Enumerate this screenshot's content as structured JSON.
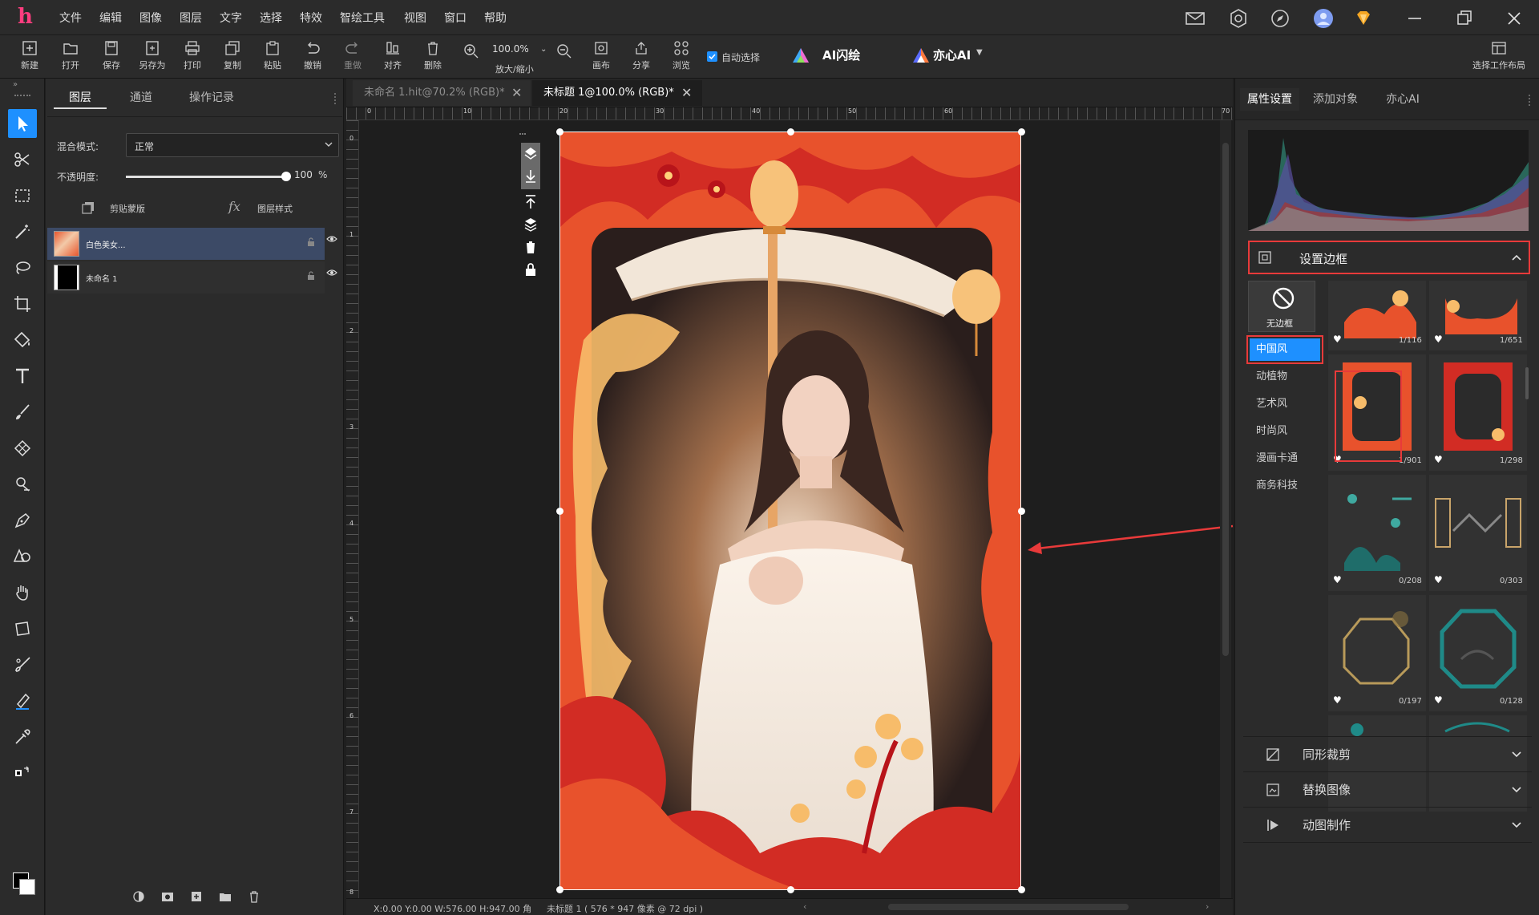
{
  "app": {
    "logo": "h",
    "colors": {
      "accent": "#1e90ff",
      "highlight": "#e83a3a",
      "bg": "#2b2b2b",
      "canvas": "#1e1e1e"
    }
  },
  "menu": [
    "文件",
    "编辑",
    "图像",
    "图层",
    "文字",
    "选择",
    "特效",
    "智绘工具",
    "视图",
    "窗口",
    "帮助"
  ],
  "toolbar": {
    "items": [
      "新建",
      "打开",
      "保存",
      "另存为",
      "打印",
      "复制",
      "粘贴",
      "撤销",
      "重做",
      "对齐",
      "删除"
    ],
    "zoom_value": "100.0%",
    "zoom_label": "放大/缩小",
    "right_items": [
      "画布",
      "分享",
      "浏览"
    ],
    "auto_select": "自动选择",
    "ai_flash": "AI闪绘",
    "yixin_ai": "亦心AI",
    "workspace": "选择工作布局"
  },
  "layers_panel": {
    "tabs": [
      "图层",
      "通道",
      "操作记录"
    ],
    "blend_label": "混合模式:",
    "blend_value": "正常",
    "opacity_label": "不透明度:",
    "opacity_value": "100",
    "opacity_unit": "%",
    "opacity_fraction": 1.0,
    "clip_mask": "剪贴蒙版",
    "layer_style": "图层样式",
    "layers": [
      {
        "name": "白色美女..."
      },
      {
        "name": "未命名 1"
      }
    ]
  },
  "doc_tabs": [
    {
      "title": "未命名 1.hit@70.2% (RGB)*"
    },
    {
      "title": "未标题 1@100.0% (RGB)*"
    }
  ],
  "ruler_marks": [
    "0",
    "10",
    "20",
    "30",
    "40",
    "50",
    "60",
    "70"
  ],
  "vruler_marks": [
    "0",
    "1",
    "2",
    "3",
    "4",
    "5",
    "6",
    "7",
    "8"
  ],
  "status": {
    "coords": "X:0.00 Y:0.00 W:576.00 H:947.00 角",
    "doc": "未标题 1 ( 576 * 947 像素 @ 72 dpi )"
  },
  "right_panel": {
    "tabs": [
      "属性设置",
      "添加对象",
      "亦心AI"
    ],
    "border_section": "设置边框",
    "no_border": "无边框",
    "categories": [
      "中国风",
      "动植物",
      "艺术风",
      "时尚风",
      "漫画卡通",
      "商务科技"
    ],
    "selected_category": "中国风",
    "thumbs": [
      {
        "count": "1/116"
      },
      {
        "count": "1/651"
      },
      {
        "count": "1/901"
      },
      {
        "count": "1/298"
      },
      {
        "count": "0/208"
      },
      {
        "count": "0/303"
      },
      {
        "count": "0/197"
      },
      {
        "count": "0/128"
      }
    ],
    "sections": [
      "同形裁剪",
      "替换图像",
      "动图制作"
    ]
  }
}
